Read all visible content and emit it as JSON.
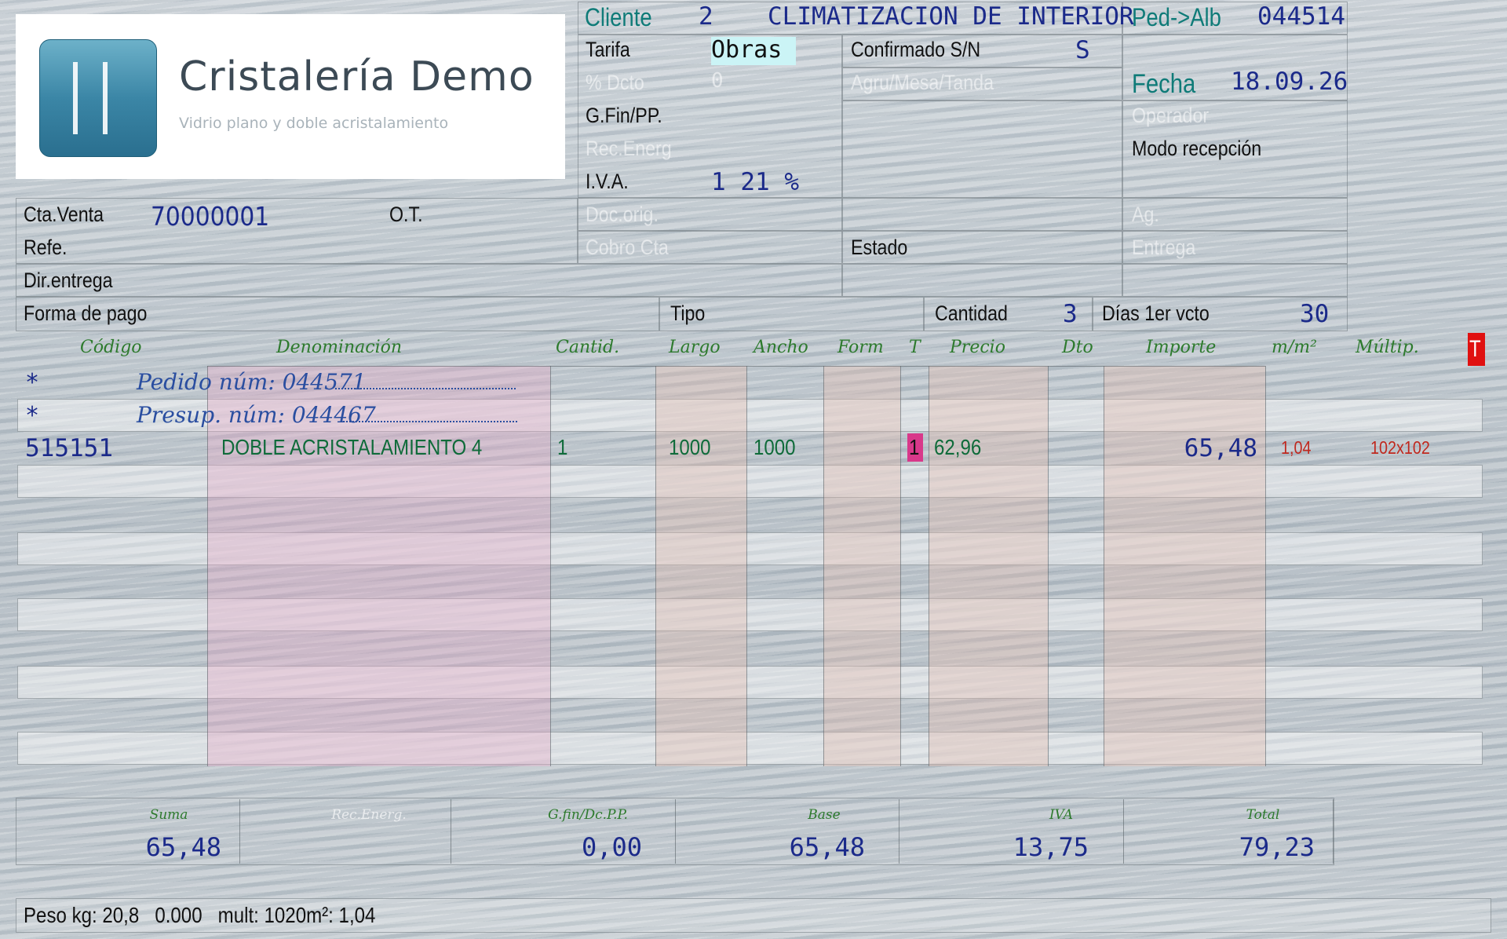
{
  "brand": {
    "name": "Cristalería Demo",
    "tagline": "Vidrio plano y doble acristalamiento"
  },
  "header": {
    "cliente_label": "Cliente",
    "cliente_num": "2",
    "cliente_name": "CLIMATIZACION DE INTERIOR",
    "pedalb_label": "Ped->Alb",
    "pedalb_num": "044514",
    "tarifa_label": "Tarifa",
    "tarifa_value": "Obras",
    "confirmado_label": "Confirmado S/N",
    "confirmado_value": "S",
    "dcto_label": "% Dcto",
    "dcto_value": "0",
    "agru_label": "Agru/Mesa/Tanda",
    "fecha_label": "Fecha",
    "fecha_value": "18.09.26",
    "gfin_label": "G.Fin/PP.",
    "operador_label": "Operador",
    "recenerg_label": "Rec.Energ",
    "modo_label": "Modo recepción",
    "iva_label": "I.V.A.",
    "iva_value": "1 21 %",
    "ctaventa_label": "Cta.Venta",
    "ctaventa_value": "70000001",
    "ot_label": "O.T.",
    "docorig_label": "Doc.orig.",
    "ag_label": "Ag.",
    "refe_label": "Refe.",
    "cobrocta_label": "Cobro Cta",
    "estado_label": "Estado",
    "entrega_label": "Entrega",
    "direntrega_label": "Dir.entrega",
    "formapago_label": "Forma de pago",
    "tipo_label": "Tipo",
    "cantidad_label": "Cantidad",
    "cantidad_value": "3",
    "dias_label": "Días 1er vcto",
    "dias_value": "30"
  },
  "columns": [
    "Código",
    "Denominación",
    "Cantid.",
    "Largo",
    "Ancho",
    "Form",
    "T",
    "Precio",
    "Dto",
    "Importe",
    "m/m²",
    "Múltip."
  ],
  "t_flag": "T",
  "notes": [
    {
      "star": "*",
      "text": "Pedido núm: 044571"
    },
    {
      "star": "*",
      "text": "Presup. núm: 044467"
    }
  ],
  "line": {
    "codigo": "515151",
    "denominacion": "DOBLE ACRISTALAMIENTO 4",
    "cantidad": "1",
    "largo": "1000",
    "ancho": "1000",
    "t": "1",
    "precio": "62,96",
    "importe": "65,48",
    "m2": "1,04",
    "multip": "102x102"
  },
  "totals": {
    "suma_label": "Suma",
    "suma": "65,48",
    "recenerg_label": "Rec.Energ.",
    "recenerg": "",
    "gfin_label": "G.fin/Dc.P.P.",
    "gfin": "0,00",
    "base_label": "Base",
    "base": "65,48",
    "iva_label": "IVA",
    "iva": "13,75",
    "total_label": "Total",
    "total": "79,23"
  },
  "footer": {
    "status": "Peso kg: 20,8   0.000   mult: 1020m²: 1,04"
  },
  "colors": {
    "value_blue": "#1b2a8a",
    "teal": "#0f7b78",
    "header_green": "#2d7a2d",
    "flag_red": "#e01010",
    "pink_flag": "#d8388a"
  }
}
